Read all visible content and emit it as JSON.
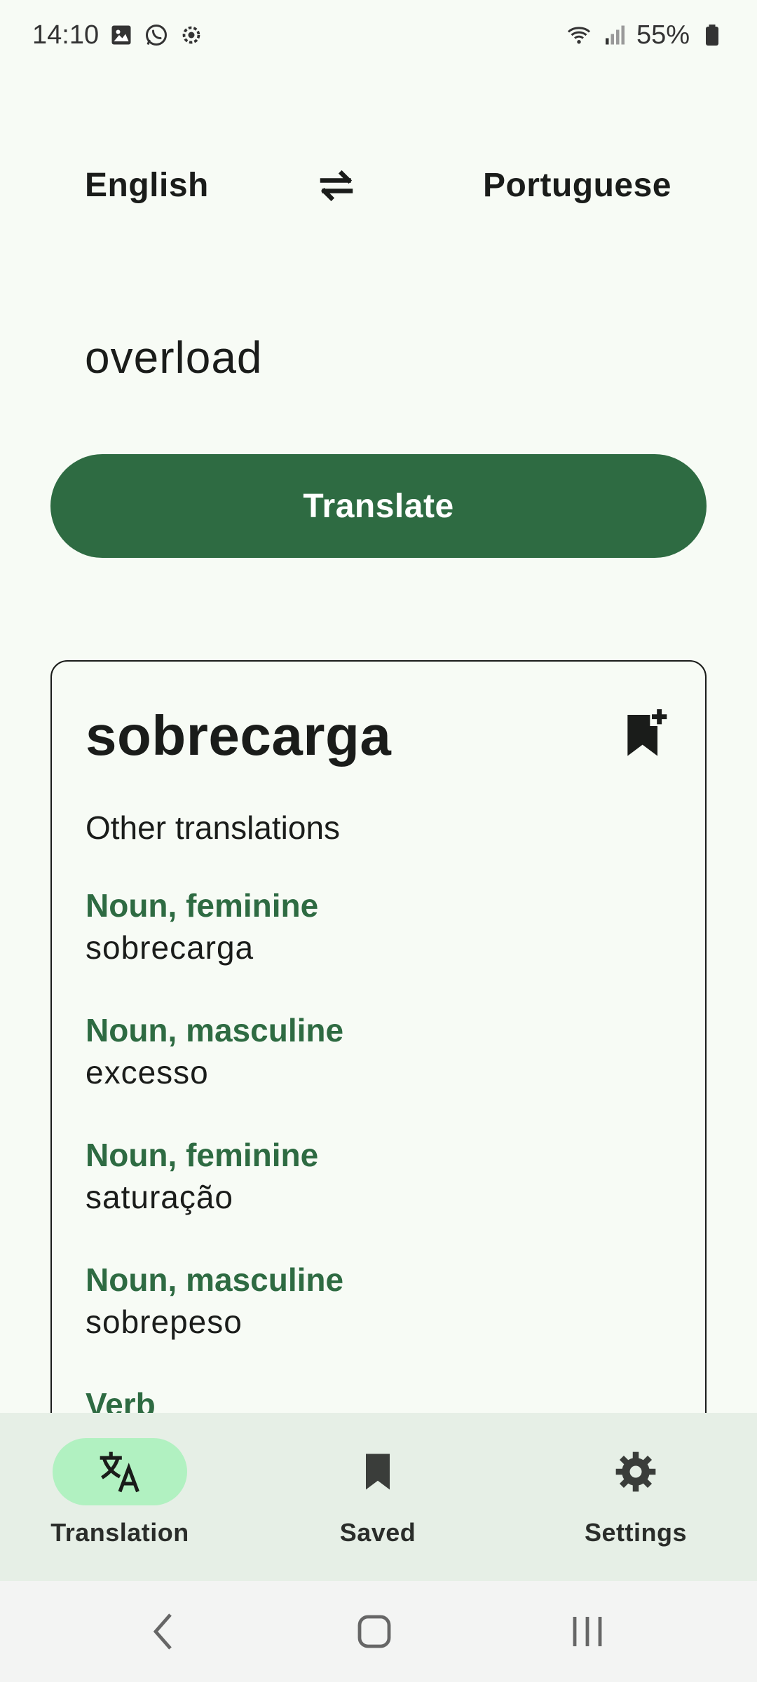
{
  "status_bar": {
    "time": "14:10",
    "battery": "55%",
    "icons": [
      "gallery-icon",
      "whatsapp-icon",
      "settings-gear-icon",
      "wifi-icon",
      "signal-icon",
      "battery-icon"
    ]
  },
  "languages": {
    "source": "English",
    "target": "Portuguese",
    "swap_icon": "swap-arrows-icon"
  },
  "input": {
    "value": "overload"
  },
  "translate_button": {
    "label": "Translate"
  },
  "result": {
    "main_translation": "sobrecarga",
    "save_icon": "bookmark-add-icon",
    "other_title": "Other translations",
    "items": [
      {
        "pos": "Noun, feminine",
        "word": "sobrecarga"
      },
      {
        "pos": "Noun, masculine",
        "word": "excesso"
      },
      {
        "pos": "Noun, feminine",
        "word": "saturação"
      },
      {
        "pos": "Noun, masculine",
        "word": "sobrepeso"
      },
      {
        "pos": "Verb",
        "word": ""
      }
    ]
  },
  "bottom_nav": {
    "items": [
      {
        "label": "Translation",
        "icon": "translate-icon",
        "active": true
      },
      {
        "label": "Saved",
        "icon": "bookmark-icon",
        "active": false
      },
      {
        "label": "Settings",
        "icon": "gear-icon",
        "active": false
      }
    ]
  },
  "colors": {
    "accent": "#2e6b42",
    "nav_background": "#e6efe6",
    "active_pill": "#b1f1c1",
    "page_background": "#f7fbf5"
  }
}
